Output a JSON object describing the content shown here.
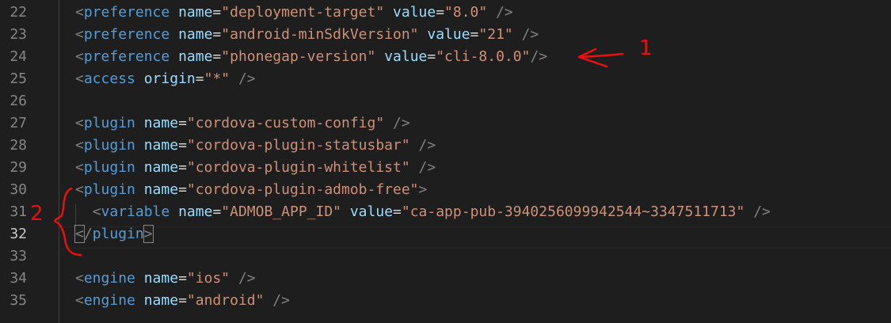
{
  "lines": [
    {
      "number": "22",
      "indent": "",
      "tag": "preference",
      "attrs": [
        {
          "name": "name",
          "value": "\"deployment-target\""
        },
        {
          "name": "value",
          "value": "\"8.0\""
        }
      ],
      "close": " />"
    },
    {
      "number": "23",
      "indent": "",
      "tag": "preference",
      "attrs": [
        {
          "name": "name",
          "value": "\"android-minSdkVersion\""
        },
        {
          "name": "value",
          "value": "\"21\""
        }
      ],
      "close": " />"
    },
    {
      "number": "24",
      "indent": "",
      "tag": "preference",
      "attrs": [
        {
          "name": "name",
          "value": "\"phonegap-version\""
        },
        {
          "name": "value",
          "value": "\"cli-8.0.0\""
        }
      ],
      "close": "/>"
    },
    {
      "number": "25",
      "indent": "",
      "tag": "access",
      "attrs": [
        {
          "name": "origin",
          "value": "\"*\""
        }
      ],
      "close": " />"
    },
    {
      "number": "26",
      "blank": true
    },
    {
      "number": "27",
      "indent": "",
      "tag": "plugin",
      "attrs": [
        {
          "name": "name",
          "value": "\"cordova-custom-config\""
        }
      ],
      "close": " />"
    },
    {
      "number": "28",
      "indent": "",
      "tag": "plugin",
      "attrs": [
        {
          "name": "name",
          "value": "\"cordova-plugin-statusbar\""
        }
      ],
      "close": " />"
    },
    {
      "number": "29",
      "indent": "",
      "tag": "plugin",
      "attrs": [
        {
          "name": "name",
          "value": "\"cordova-plugin-whitelist\""
        }
      ],
      "close": " />"
    },
    {
      "number": "30",
      "indent": "",
      "tag": "plugin",
      "attrs": [
        {
          "name": "name",
          "value": "\"cordova-plugin-admob-free\""
        }
      ],
      "close": ">"
    },
    {
      "number": "31",
      "indent": "  ",
      "tag": "variable",
      "attrs": [
        {
          "name": "name",
          "value": "\"ADMOB_APP_ID\""
        },
        {
          "name": "value",
          "value": "\"ca-app-pub-3940256099942544~3347511713\""
        }
      ],
      "close": " />"
    },
    {
      "number": "32",
      "indent": "",
      "closing_tag": "plugin",
      "active": true
    },
    {
      "number": "33",
      "blank": true
    },
    {
      "number": "34",
      "indent": "",
      "tag": "engine",
      "attrs": [
        {
          "name": "name",
          "value": "\"ios\""
        }
      ],
      "close": " />"
    },
    {
      "number": "35",
      "indent": "",
      "tag": "engine",
      "attrs": [
        {
          "name": "name",
          "value": "\"android\""
        }
      ],
      "close": " />"
    }
  ],
  "annotations": {
    "label_1": "1",
    "label_2": "2",
    "color": "#e81010"
  },
  "colors": {
    "background": "#1e1e1e",
    "tag": "#569cd6",
    "attribute": "#9cdcfe",
    "string": "#ce9178",
    "bracket": "#808080",
    "line_number": "#858585"
  }
}
